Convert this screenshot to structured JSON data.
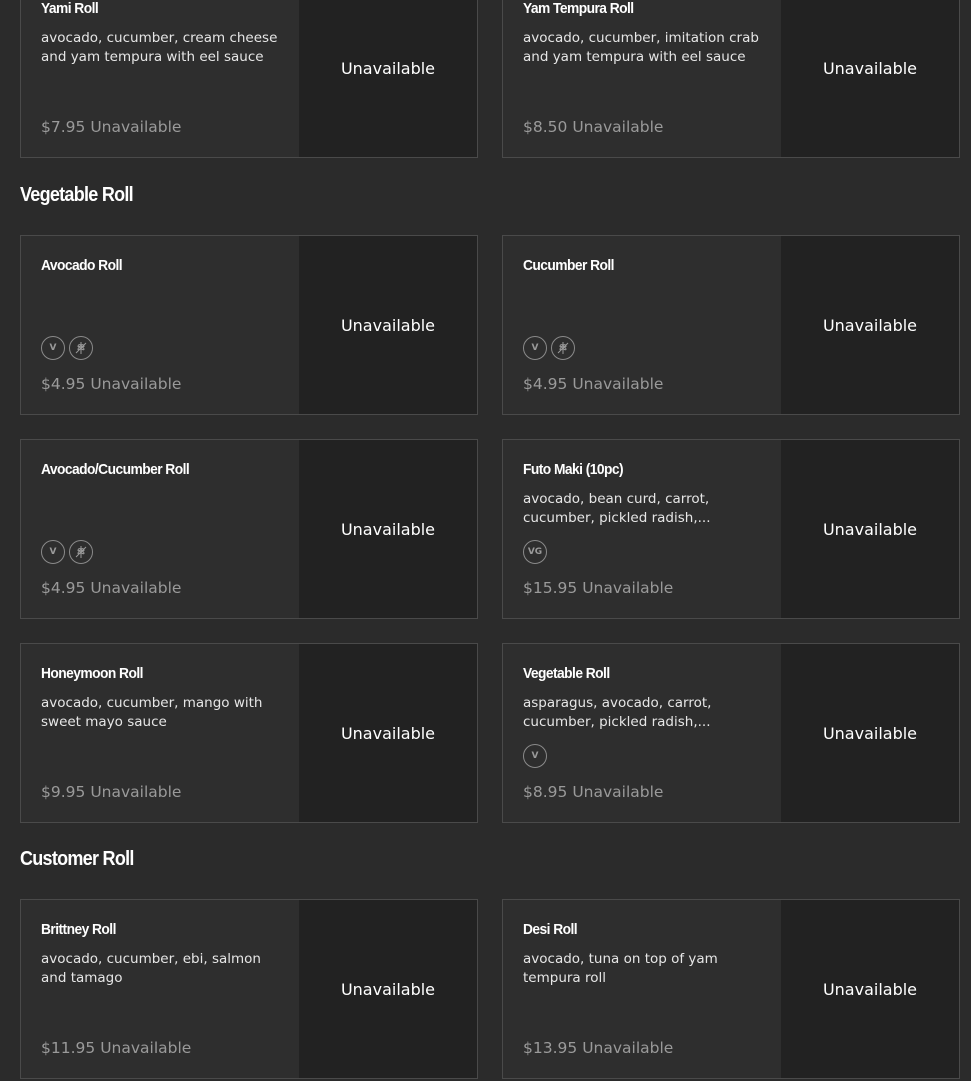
{
  "sections": [
    {
      "title": null,
      "items": [
        {
          "name": "Yami Roll",
          "desc": "avocado, cucumber, cream cheese and yam tempura with eel sauce",
          "price": "$7.95",
          "availability": "Unavailable",
          "tags": [],
          "image_status": "Unavailable"
        },
        {
          "name": "Yam Tempura Roll",
          "desc": "avocado, cucumber, imitation crab and yam tempura with eel sauce",
          "price": "$8.50",
          "availability": "Unavailable",
          "tags": [],
          "image_status": "Unavailable"
        }
      ]
    },
    {
      "title": "Vegetable Roll",
      "items": [
        {
          "name": "Avocado Roll",
          "desc": "",
          "price": "$4.95",
          "availability": "Unavailable",
          "tags": [
            "vegan-icon",
            "gluten-free-icon"
          ],
          "image_status": "Unavailable"
        },
        {
          "name": "Cucumber Roll",
          "desc": "",
          "price": "$4.95",
          "availability": "Unavailable",
          "tags": [
            "vegan-icon",
            "gluten-free-icon"
          ],
          "image_status": "Unavailable"
        },
        {
          "name": "Avocado/Cucumber Roll",
          "desc": "",
          "price": "$4.95",
          "availability": "Unavailable",
          "tags": [
            "vegan-icon",
            "gluten-free-icon"
          ],
          "image_status": "Unavailable"
        },
        {
          "name": "Futo Maki (10pc)",
          "desc": "avocado, bean curd, carrot, cucumber, pickled radish,...",
          "price": "$15.95",
          "availability": "Unavailable",
          "tags": [
            "vegetarian-icon"
          ],
          "image_status": "Unavailable"
        },
        {
          "name": "Honeymoon Roll",
          "desc": "avocado, cucumber, mango with sweet mayo sauce",
          "price": "$9.95",
          "availability": "Unavailable",
          "tags": [],
          "image_status": "Unavailable"
        },
        {
          "name": "Vegetable Roll",
          "desc": "asparagus, avocado, carrot, cucumber, pickled radish,...",
          "price": "$8.95",
          "availability": "Unavailable",
          "tags": [
            "vegan-icon"
          ],
          "image_status": "Unavailable"
        }
      ]
    },
    {
      "title": "Customer Roll",
      "items": [
        {
          "name": "Brittney Roll",
          "desc": "avocado, cucumber, ebi, salmon and tamago",
          "price": "$11.95",
          "availability": "Unavailable",
          "tags": [],
          "image_status": "Unavailable"
        },
        {
          "name": "Desi Roll",
          "desc": "avocado, tuna on top of yam tempura roll",
          "price": "$13.95",
          "availability": "Unavailable",
          "tags": [],
          "image_status": "Unavailable"
        }
      ]
    }
  ],
  "tag_glyphs": {
    "vegan-icon": "V",
    "vegetarian-icon": "VG"
  }
}
